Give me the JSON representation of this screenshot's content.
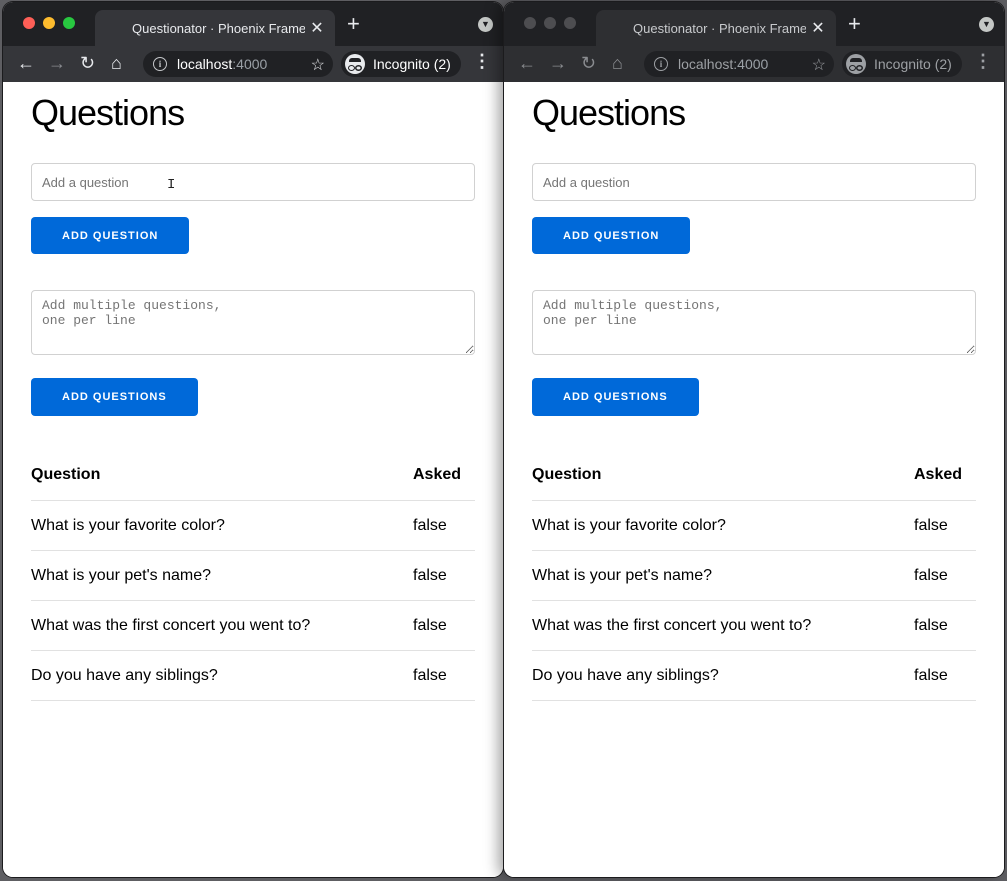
{
  "browser": {
    "tab_title": "Questionator · Phoenix Framework",
    "tab_close_glyph": "✕",
    "new_tab_glyph": "+",
    "url_host": "localhost",
    "url_port": ":4000",
    "incognito_label": "Incognito (2)",
    "colors": {
      "close": "#fe5f57",
      "minimize": "#febc2e",
      "maximize": "#28c840",
      "inactive": "#4d4d50"
    }
  },
  "page": {
    "title": "Questions",
    "single_input_placeholder": "Add a question",
    "add_question_label": "Add question",
    "multi_input_placeholder": "Add multiple questions,\none per line",
    "add_questions_label": "Add questions",
    "table": {
      "headers": [
        "Question",
        "Asked"
      ],
      "rows": [
        [
          "What is your favorite color?",
          "false"
        ],
        [
          "What is your pet's name?",
          "false"
        ],
        [
          "What was the first concert you went to?",
          "false"
        ],
        [
          "Do you have any siblings?",
          "false"
        ]
      ]
    }
  }
}
